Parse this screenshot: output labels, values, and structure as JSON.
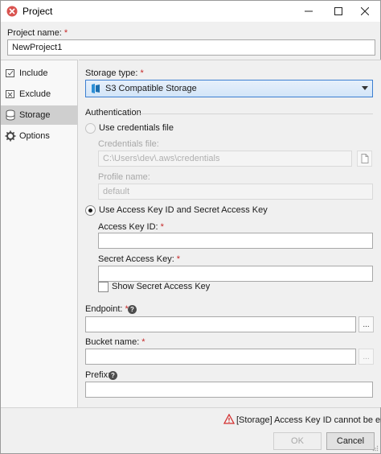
{
  "window": {
    "title": "Project"
  },
  "project": {
    "name_label": "Project name:",
    "name_value": "NewProject1"
  },
  "sidebar": {
    "items": [
      {
        "label": "Include",
        "icon": "include-icon"
      },
      {
        "label": "Exclude",
        "icon": "exclude-icon"
      },
      {
        "label": "Storage",
        "icon": "storage-icon"
      },
      {
        "label": "Options",
        "icon": "gear-icon"
      }
    ],
    "active": "Storage"
  },
  "storage": {
    "type_label": "Storage type:",
    "type_value": "S3 Compatible Storage",
    "auth_heading": "Authentication",
    "opt_credentials_file": "Use credentials file",
    "credentials_file_label": "Credentials file:",
    "credentials_file_placeholder": "C:\\Users\\dev\\.aws\\credentials",
    "profile_name_label": "Profile name:",
    "profile_name_placeholder": "default",
    "opt_access_key": "Use Access Key ID and Secret Access Key",
    "access_key_label": "Access Key ID:",
    "secret_key_label": "Secret Access Key:",
    "show_secret_label": "Show Secret Access Key",
    "endpoint_label": "Endpoint:",
    "bucket_label": "Bucket name:",
    "prefix_label": "Prefix:",
    "browse_label": "..."
  },
  "status": {
    "error": "[Storage] Access Key ID cannot be empty"
  },
  "buttons": {
    "ok": "OK",
    "cancel": "Cancel"
  },
  "colors": {
    "required": "#c62828",
    "error": "#d32f2f",
    "selection": "#3c7fd1"
  }
}
